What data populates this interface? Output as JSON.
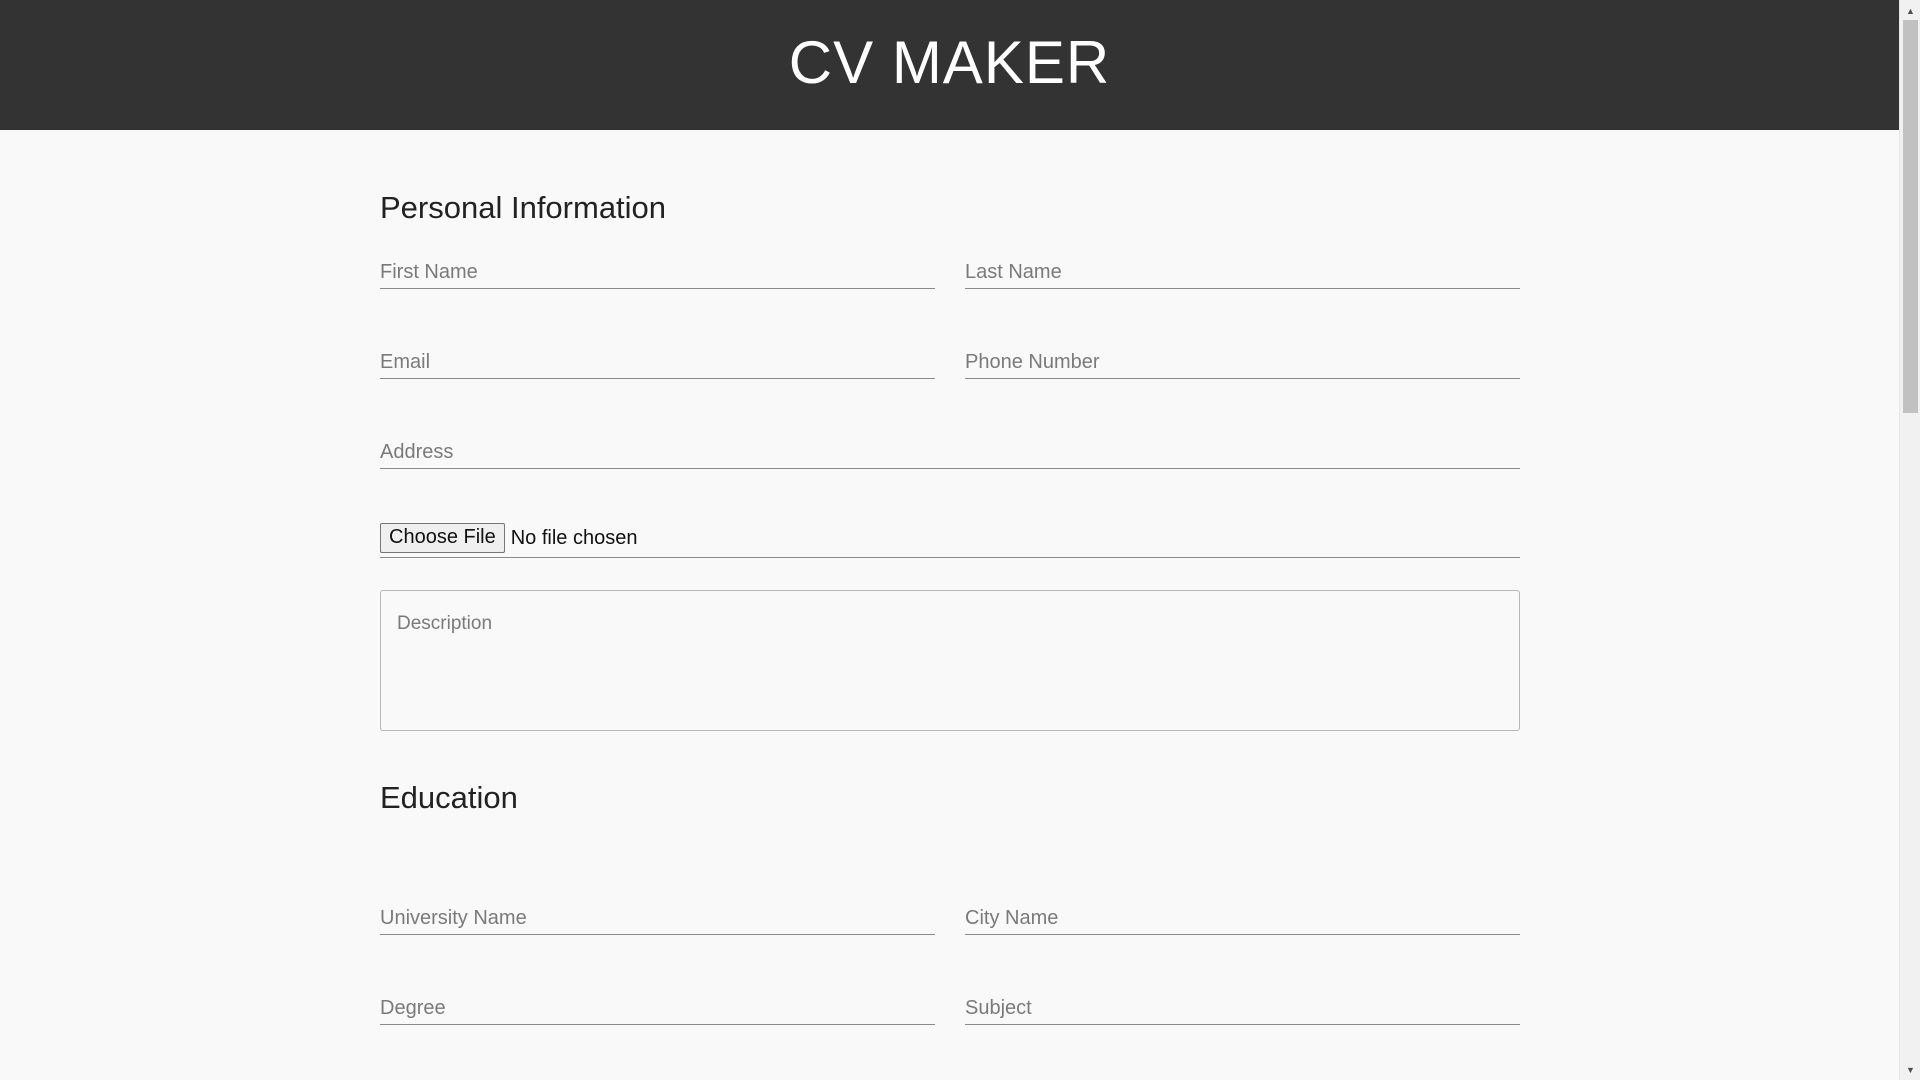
{
  "header": {
    "title": "CV MAKER"
  },
  "personal": {
    "title": "Personal Information",
    "first_name_placeholder": "First Name",
    "last_name_placeholder": "Last Name",
    "email_placeholder": "Email",
    "phone_placeholder": "Phone Number",
    "address_placeholder": "Address",
    "file_button_label": "Choose File",
    "file_status": "No file chosen",
    "description_placeholder": "Description"
  },
  "education": {
    "title": "Education",
    "university_placeholder": "University Name",
    "city_placeholder": "City Name",
    "degree_placeholder": "Degree",
    "subject_placeholder": "Subject"
  },
  "scrollbar": {
    "up_icon": "triangle-up",
    "down_icon": "triangle-down"
  }
}
